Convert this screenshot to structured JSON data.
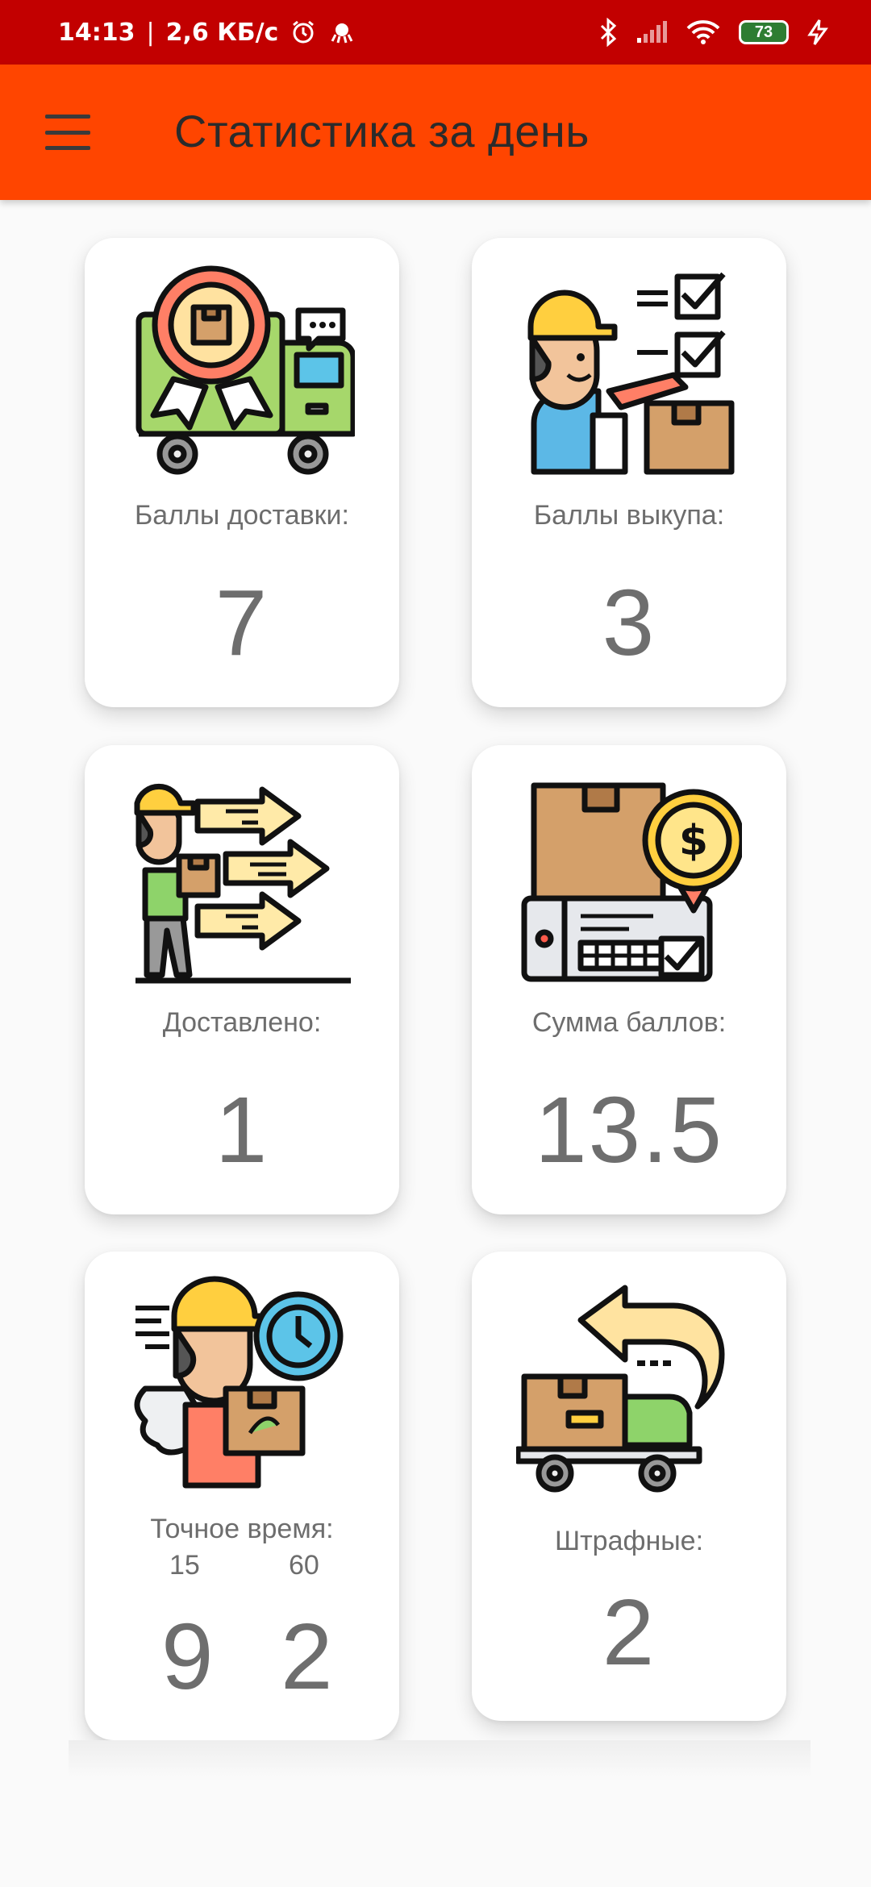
{
  "status_bar": {
    "time": "14:13",
    "speed": "2,6 КБ/с",
    "battery": "73"
  },
  "app_bar": {
    "title": "Статистика за день"
  },
  "cards": [
    {
      "icon": "delivery-truck-badge-icon",
      "label": "Баллы доставки:",
      "value": "7"
    },
    {
      "icon": "courier-checklist-icon",
      "label": "Баллы выкупа:",
      "value": "3"
    },
    {
      "icon": "courier-delivered-icon",
      "label": "Доставлено:",
      "value": "1"
    },
    {
      "icon": "invoice-coin-icon",
      "label": "Сумма баллов:",
      "value": "13.5"
    },
    {
      "icon": "fast-courier-clock-icon",
      "label": "Точное время:",
      "sub": [
        "15",
        "60"
      ],
      "values": [
        "9",
        "2"
      ]
    },
    {
      "icon": "truck-return-icon",
      "label": "Штрафные:",
      "value": "2"
    }
  ],
  "colors": {
    "status_bar": "#c20000",
    "app_bar": "#ff4500",
    "background": "#fafafa"
  }
}
